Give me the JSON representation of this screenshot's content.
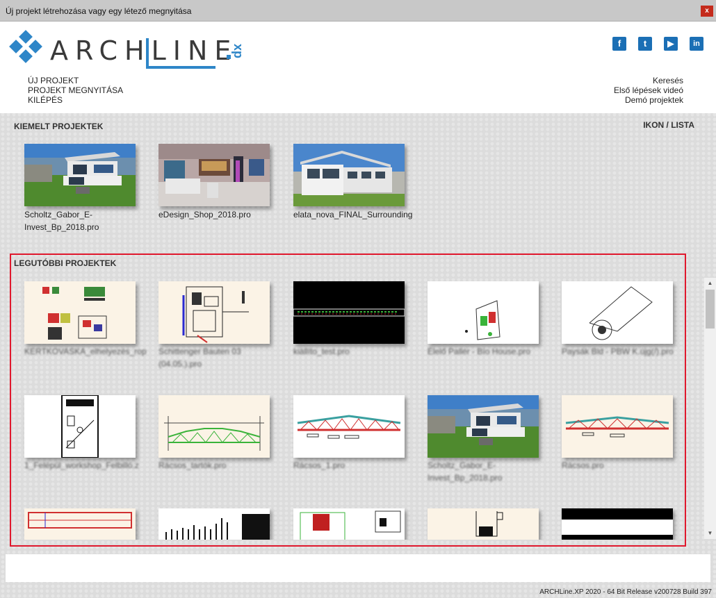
{
  "window": {
    "title": "Új projekt létrehozása vagy egy létező megnyitása",
    "close_label": "x"
  },
  "logo": {
    "text": "ARCHLINE",
    "suffix": "xp"
  },
  "social": [
    {
      "icon": "facebook-icon",
      "glyph": "f"
    },
    {
      "icon": "twitter-icon",
      "glyph": "t"
    },
    {
      "icon": "youtube-icon",
      "glyph": "▶"
    },
    {
      "icon": "linkedin-icon",
      "glyph": "in"
    }
  ],
  "menu": {
    "new_project": "ÚJ PROJEKT",
    "open_project": "PROJEKT MEGNYITÁSA",
    "exit": "KILÉPÉS"
  },
  "links": {
    "search": "Keresés",
    "first_steps_video": "Első lépések videó",
    "demo_projects": "Demó projektek"
  },
  "featured": {
    "title": "KIEMELT PROJEKTEK",
    "view_toggle": "IKON / LISTA",
    "items": [
      {
        "label": "Scholtz_Gabor_E-Invest_Bp_2018.pro"
      },
      {
        "label": "eDesign_Shop_2018.pro"
      },
      {
        "label": "elata_nova_FINAL_Surrounding"
      }
    ]
  },
  "recent": {
    "title": "LEGUTÓBBI PROJEKTEK",
    "items": [
      {
        "label": "KERTKOVASKA_elhelyezés_rop"
      },
      {
        "label": "Schittenger Bauten 03 (04.05.).pro"
      },
      {
        "label": "kiállíto_test.pro"
      },
      {
        "label": "Élelő Pallér - Bío House.pro"
      },
      {
        "label": "Paysák Bld - PBW K.újg(/).pro"
      },
      {
        "label": "1_Felépül_workshop_Felbilló.z"
      },
      {
        "label": "Rácsos_tartók.pro"
      },
      {
        "label": "Rácsos_1.pro"
      },
      {
        "label": "Scholtz_Gabor_E-Invest_Bp_2018.pro"
      },
      {
        "label": "Rácsos.pro"
      }
    ]
  },
  "status_bar": {
    "text": "ARCHLine.XP 2020 - 64 Bit Release v200728 Build 397"
  },
  "colors": {
    "accent": "#2e86c8",
    "highlight_border": "#e0182d",
    "close": "#c42b1c"
  }
}
